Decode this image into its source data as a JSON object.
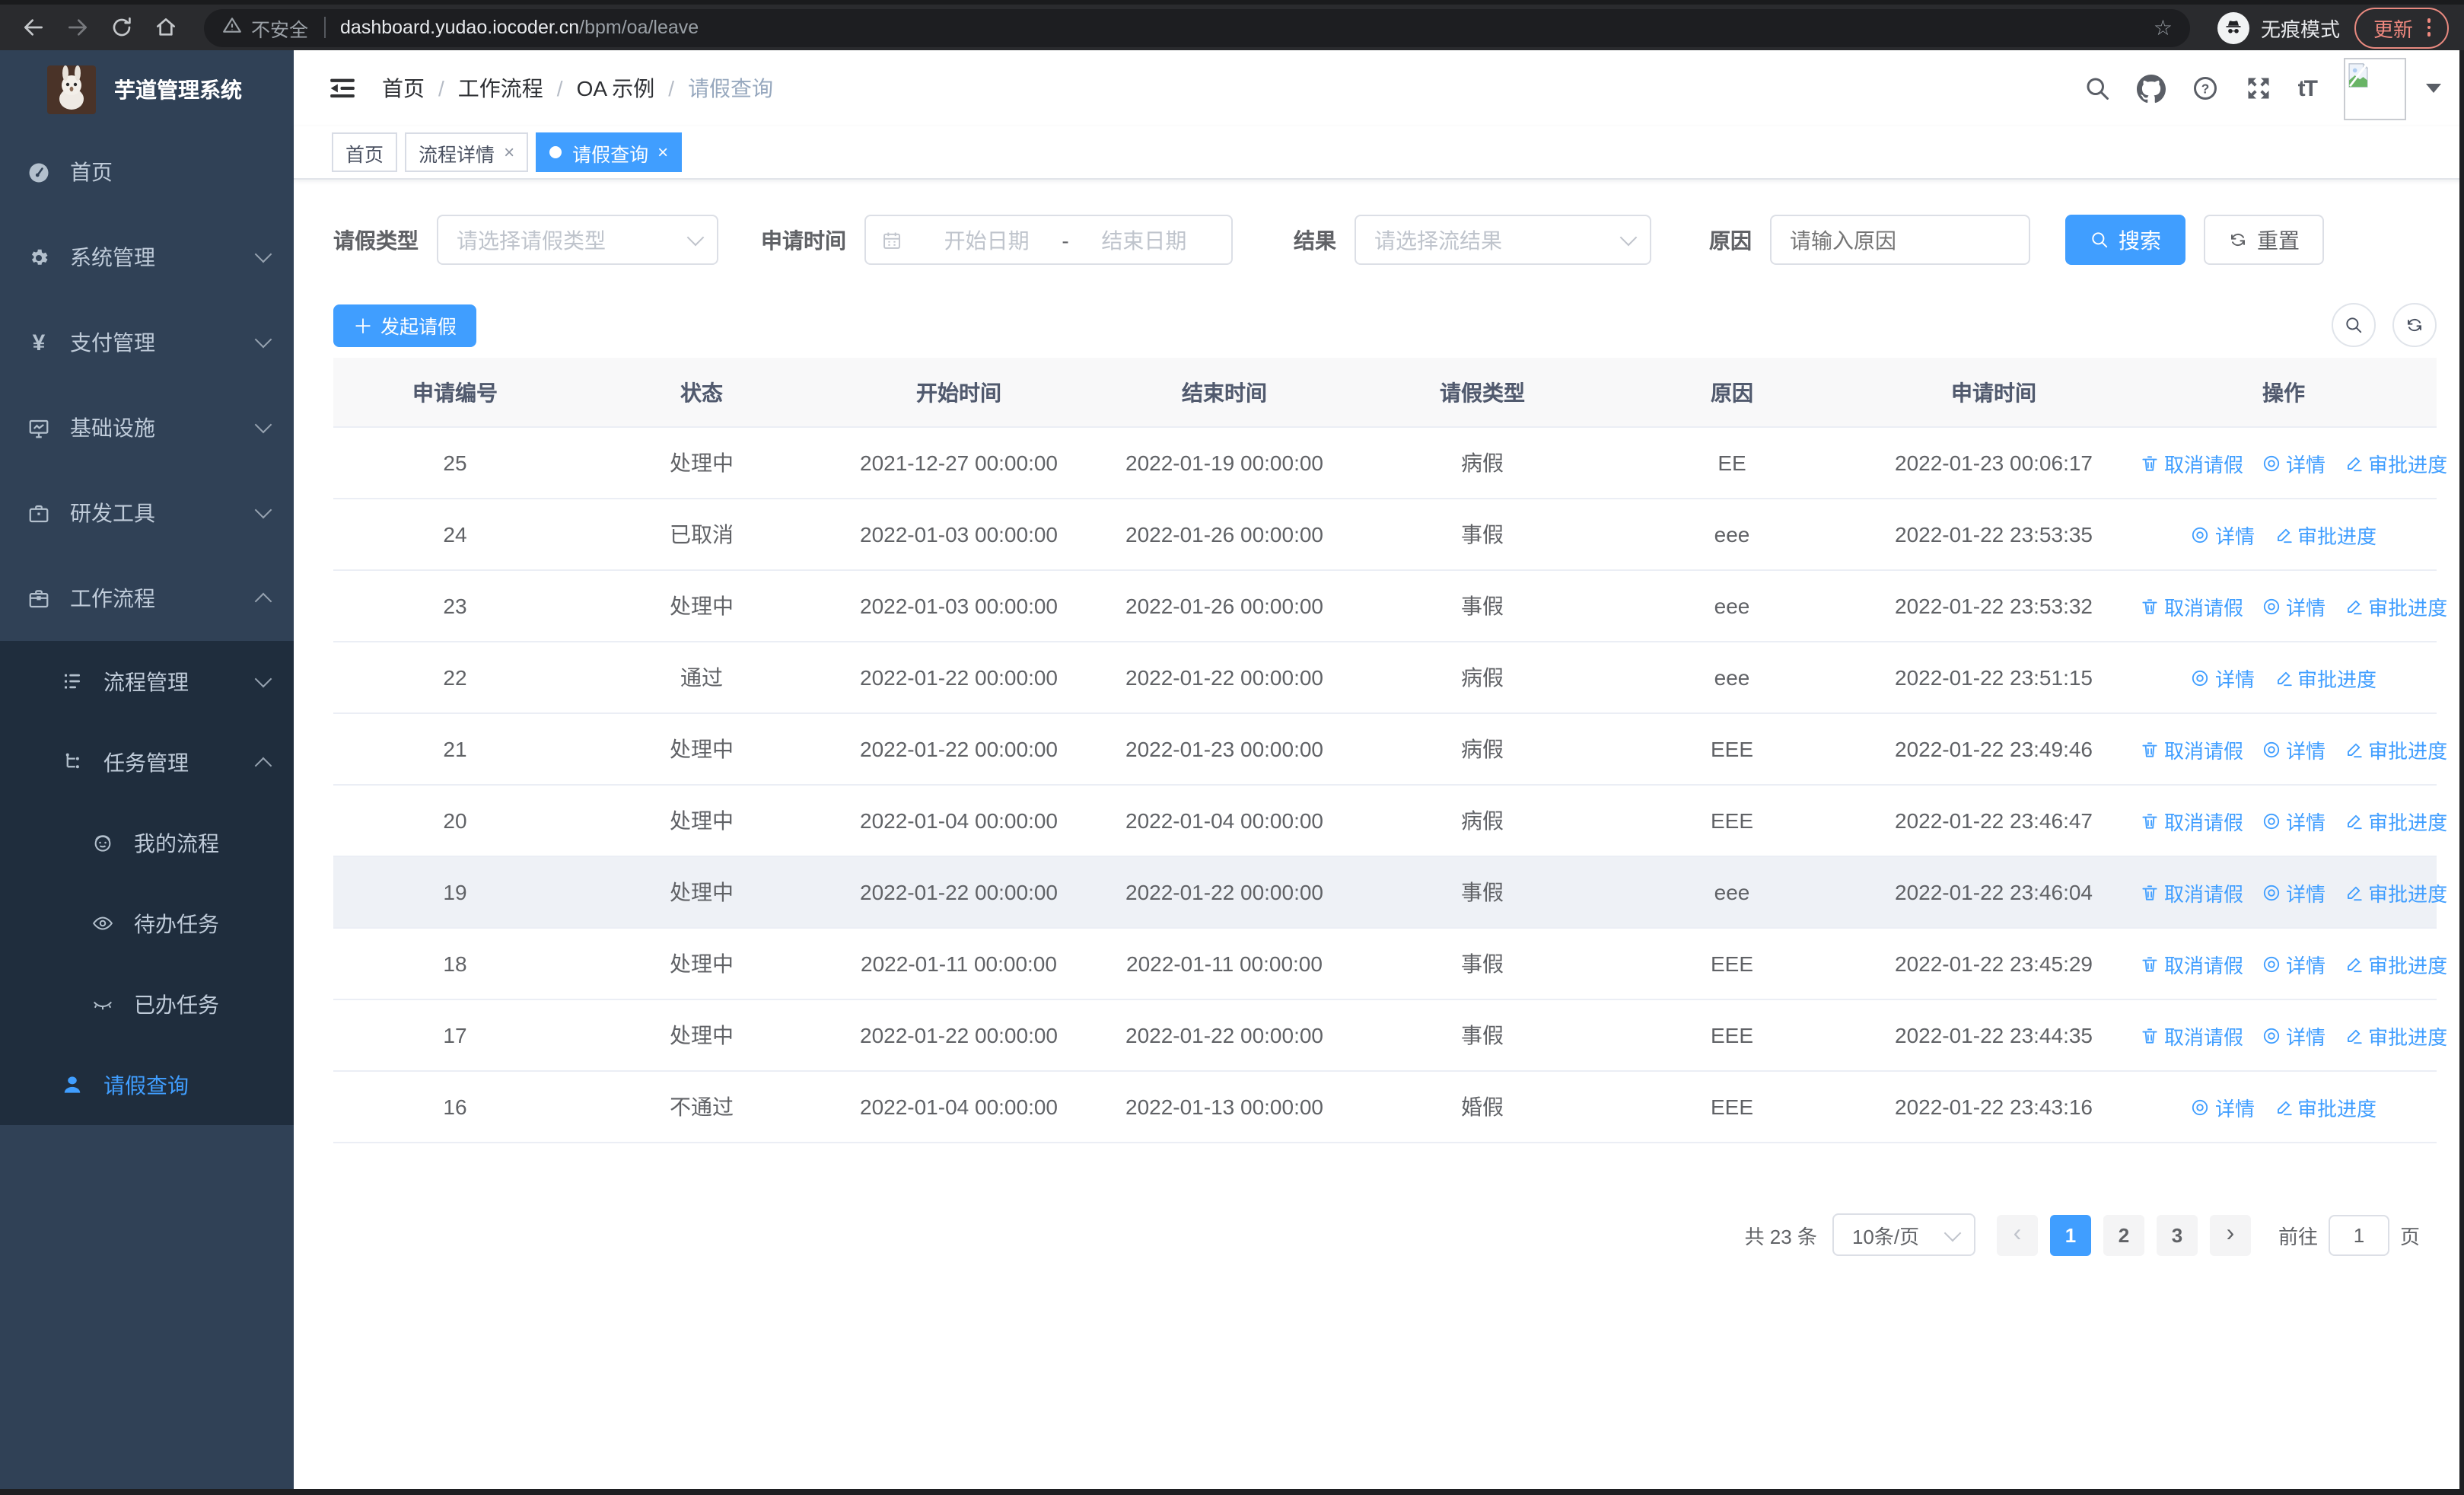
{
  "browser": {
    "security_label": "不安全",
    "url_host": "dashboard.yudao.iocoder.cn",
    "url_path": "/bpm/oa/leave",
    "incognito_label": "无痕模式",
    "update_label": "更新"
  },
  "icons": {
    "star": "☆",
    "close": "×",
    "plus": "＋",
    "yen": "¥",
    "question": "?",
    "font_size_glyph": "tT",
    "breadcrumb_sep": "/",
    "prev_arrow": "‹",
    "next_arrow": "›"
  },
  "sidebar": {
    "title": "芋道管理系统",
    "items": [
      {
        "label": "首页"
      },
      {
        "label": "系统管理"
      },
      {
        "label": "支付管理"
      },
      {
        "label": "基础设施"
      },
      {
        "label": "研发工具"
      },
      {
        "label": "工作流程"
      },
      {
        "label": "流程管理"
      },
      {
        "label": "任务管理"
      },
      {
        "label": "我的流程"
      },
      {
        "label": "待办任务"
      },
      {
        "label": "已办任务"
      },
      {
        "label": "请假查询"
      }
    ]
  },
  "header": {
    "breadcrumb": [
      "首页",
      "工作流程",
      "OA 示例",
      "请假查询"
    ]
  },
  "tabs": [
    {
      "label": "首页"
    },
    {
      "label": "流程详情"
    },
    {
      "label": "请假查询"
    }
  ],
  "filters": {
    "leave_type_label": "请假类型",
    "leave_type_placeholder": "请选择请假类型",
    "apply_time_label": "申请时间",
    "start_date_placeholder": "开始日期",
    "range_separator": "-",
    "end_date_placeholder": "结束日期",
    "result_label": "结果",
    "result_placeholder": "请选择流结果",
    "reason_label": "原因",
    "reason_placeholder": "请输入原因",
    "search_label": "搜索",
    "reset_label": "重置"
  },
  "toolbar": {
    "create_label": "发起请假"
  },
  "table": {
    "columns": [
      "申请编号",
      "状态",
      "开始时间",
      "结束时间",
      "请假类型",
      "原因",
      "申请时间",
      "操作"
    ],
    "action_labels": {
      "cancel": "取消请假",
      "detail": "详情",
      "progress": "审批进度"
    },
    "rows": [
      {
        "id": "25",
        "status": "处理中",
        "start": "2021-12-27 00:00:00",
        "end": "2022-01-19 00:00:00",
        "type": "病假",
        "reason": "EE",
        "applied": "2022-01-23 00:06:17",
        "cancellable": true,
        "highlight": false
      },
      {
        "id": "24",
        "status": "已取消",
        "start": "2022-01-03 00:00:00",
        "end": "2022-01-26 00:00:00",
        "type": "事假",
        "reason": "eee",
        "applied": "2022-01-22 23:53:35",
        "cancellable": false,
        "highlight": false
      },
      {
        "id": "23",
        "status": "处理中",
        "start": "2022-01-03 00:00:00",
        "end": "2022-01-26 00:00:00",
        "type": "事假",
        "reason": "eee",
        "applied": "2022-01-22 23:53:32",
        "cancellable": true,
        "highlight": false
      },
      {
        "id": "22",
        "status": "通过",
        "start": "2022-01-22 00:00:00",
        "end": "2022-01-22 00:00:00",
        "type": "病假",
        "reason": "eee",
        "applied": "2022-01-22 23:51:15",
        "cancellable": false,
        "highlight": false
      },
      {
        "id": "21",
        "status": "处理中",
        "start": "2022-01-22 00:00:00",
        "end": "2022-01-23 00:00:00",
        "type": "病假",
        "reason": "EEE",
        "applied": "2022-01-22 23:49:46",
        "cancellable": true,
        "highlight": false
      },
      {
        "id": "20",
        "status": "处理中",
        "start": "2022-01-04 00:00:00",
        "end": "2022-01-04 00:00:00",
        "type": "病假",
        "reason": "EEE",
        "applied": "2022-01-22 23:46:47",
        "cancellable": true,
        "highlight": false
      },
      {
        "id": "19",
        "status": "处理中",
        "start": "2022-01-22 00:00:00",
        "end": "2022-01-22 00:00:00",
        "type": "事假",
        "reason": "eee",
        "applied": "2022-01-22 23:46:04",
        "cancellable": true,
        "highlight": true
      },
      {
        "id": "18",
        "status": "处理中",
        "start": "2022-01-11 00:00:00",
        "end": "2022-01-11 00:00:00",
        "type": "事假",
        "reason": "EEE",
        "applied": "2022-01-22 23:45:29",
        "cancellable": true,
        "highlight": false
      },
      {
        "id": "17",
        "status": "处理中",
        "start": "2022-01-22 00:00:00",
        "end": "2022-01-22 00:00:00",
        "type": "事假",
        "reason": "EEE",
        "applied": "2022-01-22 23:44:35",
        "cancellable": true,
        "highlight": false
      },
      {
        "id": "16",
        "status": "不通过",
        "start": "2022-01-04 00:00:00",
        "end": "2022-01-13 00:00:00",
        "type": "婚假",
        "reason": "EEE",
        "applied": "2022-01-22 23:43:16",
        "cancellable": false,
        "highlight": false
      }
    ]
  },
  "pagination": {
    "total_label": "共 23 条",
    "page_size": "10条/页",
    "pages": [
      "1",
      "2",
      "3"
    ],
    "active_page": "1",
    "goto_label": "前往",
    "goto_value": "1",
    "page_unit": "页"
  }
}
